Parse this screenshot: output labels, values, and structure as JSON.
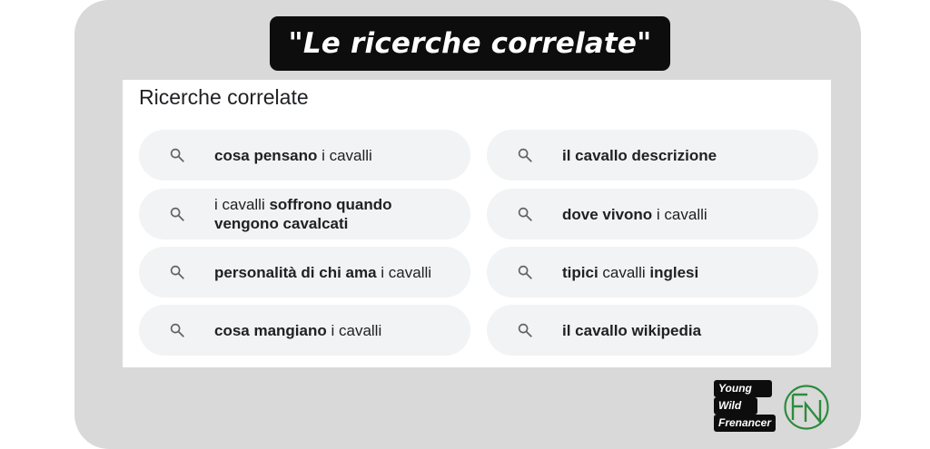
{
  "header": {
    "title": "\"Le ricerche correlate\""
  },
  "related": {
    "title": "Ricerche correlate",
    "items": [
      {
        "segments": [
          {
            "t": "cosa pensano",
            "b": true
          },
          {
            "t": " i cavalli",
            "b": false
          }
        ]
      },
      {
        "segments": [
          {
            "t": "il cavallo descrizione",
            "b": true
          }
        ]
      },
      {
        "segments": [
          {
            "t": "i cavalli ",
            "b": false
          },
          {
            "t": "soffrono quando vengono cavalcati",
            "b": true
          }
        ]
      },
      {
        "segments": [
          {
            "t": "dove vivono",
            "b": true
          },
          {
            "t": " i cavalli",
            "b": false
          }
        ]
      },
      {
        "segments": [
          {
            "t": "personalità di chi ama",
            "b": true
          },
          {
            "t": " i cavalli",
            "b": false
          }
        ]
      },
      {
        "segments": [
          {
            "t": "tipici",
            "b": true
          },
          {
            "t": " cavalli ",
            "b": false
          },
          {
            "t": "inglesi",
            "b": true
          }
        ]
      },
      {
        "segments": [
          {
            "t": "cosa mangiano",
            "b": true
          },
          {
            "t": " i cavalli",
            "b": false
          }
        ]
      },
      {
        "segments": [
          {
            "t": "il cavallo wikipedia",
            "b": true
          }
        ]
      }
    ],
    "icon": "search-icon"
  },
  "brand": {
    "line1": "Young",
    "line2": "Wild",
    "line3": "Frenancer",
    "logo_letters": "FN",
    "logo_color": "#2e8b3d"
  },
  "colors": {
    "frame": "#d9d9d9",
    "chip": "#f1f3f4",
    "text": "#202124",
    "icon": "#5f6368"
  }
}
